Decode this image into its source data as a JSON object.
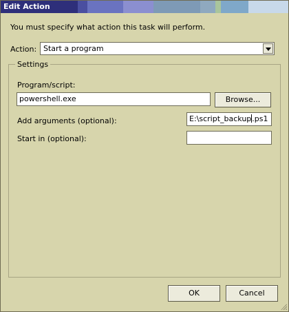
{
  "window": {
    "title": "Edit Action"
  },
  "instruction": "You must specify what action this task will perform.",
  "action": {
    "label": "Action:",
    "selected": "Start a program"
  },
  "settings": {
    "legend": "Settings",
    "program_label": "Program/script:",
    "program_value": "powershell.exe",
    "browse_label": "Browse...",
    "args_label": "Add arguments (optional):",
    "args_value_before_caret": "E:\\script_backup",
    "args_value_after_caret": ".ps1",
    "startin_label": "Start in (optional):",
    "startin_value": ""
  },
  "buttons": {
    "ok": "OK",
    "cancel": "Cancel"
  },
  "icons": {
    "dropdown": "chevron-down-icon",
    "resize": "resize-grip-icon"
  },
  "colors": {
    "dialog_background": "#d7d5ac",
    "title_text": "#ffffff"
  }
}
